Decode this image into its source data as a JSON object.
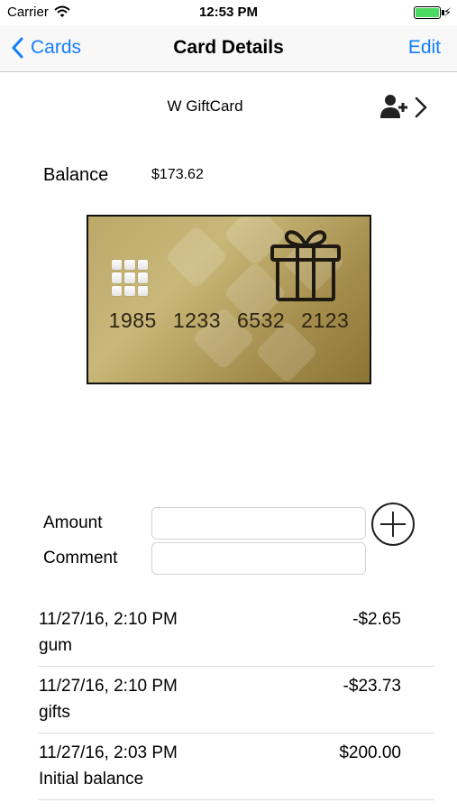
{
  "status_bar": {
    "carrier": "Carrier",
    "time": "12:53 PM",
    "battery_level": 1.0,
    "battery_color": "#4cd964"
  },
  "nav": {
    "back_label": "Cards",
    "title": "Card Details",
    "edit_label": "Edit",
    "accent_color": "#147efb"
  },
  "card": {
    "name": "W GiftCard",
    "balance_label": "Balance",
    "balance_value": "$173.62",
    "number_groups": [
      "1985",
      "1233",
      "6532",
      "2123"
    ],
    "icon": "gift-icon",
    "share_icon": "add-person-icon"
  },
  "form": {
    "amount_label": "Amount",
    "amount_value": "",
    "comment_label": "Comment",
    "comment_value": "",
    "add_icon": "plus-circle-icon"
  },
  "transactions": [
    {
      "date": "11/27/16, 2:10 PM",
      "comment": "gum",
      "amount": "-$2.65"
    },
    {
      "date": "11/27/16, 2:10 PM",
      "comment": "gifts",
      "amount": "-$23.73"
    },
    {
      "date": "11/27/16, 2:03 PM",
      "comment": "Initial balance",
      "amount": "$200.00"
    }
  ]
}
